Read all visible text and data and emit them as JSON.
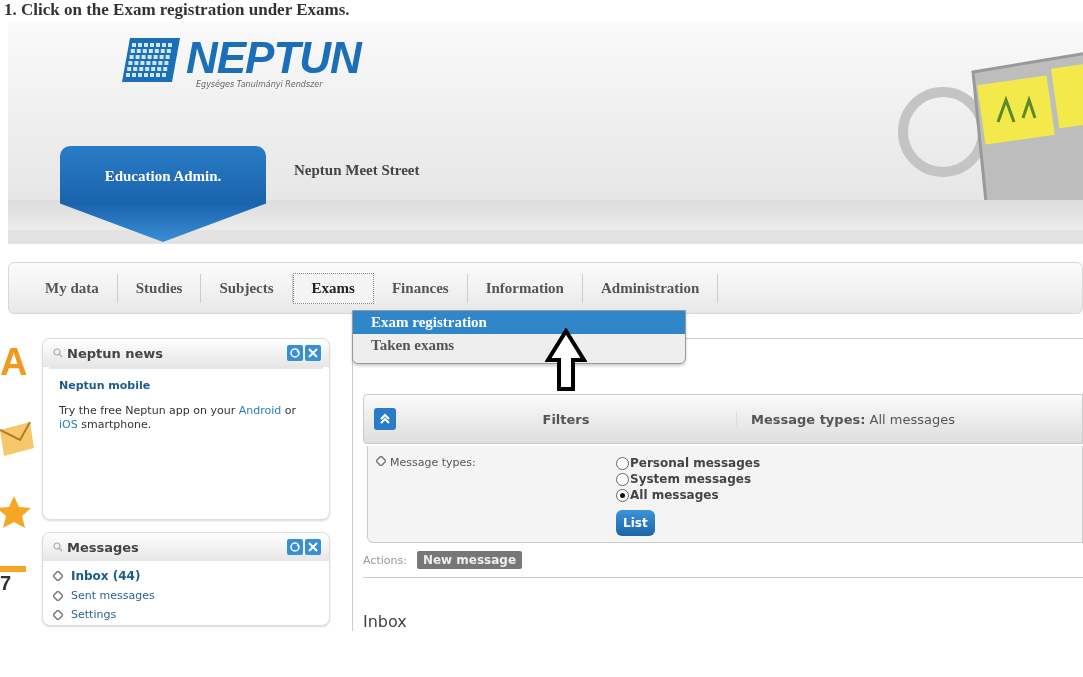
{
  "caption": "1. Click on the Exam registration under Exams.",
  "logo": {
    "name": "NEPTUN",
    "tagline": "Egységes Tanulmányi Rendszer"
  },
  "header_tabs": [
    {
      "label": "Education Admin.",
      "selected": true
    },
    {
      "label": "Neptun Meet Street",
      "selected": false
    }
  ],
  "menu": [
    {
      "label": "My data",
      "selected": false
    },
    {
      "label": "Studies",
      "selected": false
    },
    {
      "label": "Subjects",
      "selected": false
    },
    {
      "label": "Exams",
      "selected": true
    },
    {
      "label": "Finances",
      "selected": false
    },
    {
      "label": "Information",
      "selected": false
    },
    {
      "label": "Administration",
      "selected": false
    }
  ],
  "dropdown": [
    {
      "label": "Exam registration",
      "selected": true
    },
    {
      "label": "Taken exams",
      "selected": false
    }
  ],
  "side_letter": "A",
  "side_calendar_day": "7",
  "news_box": {
    "title": "Neptun news",
    "headline": "Neptun mobile",
    "body": [
      {
        "kind": "text",
        "text": "Try the free Neptun app on your"
      },
      {
        "kind": "link",
        "text": "Android"
      },
      {
        "kind": "text",
        "text": "or"
      },
      {
        "kind": "link",
        "text": "iOS"
      },
      {
        "kind": "text",
        "text": "smartphone."
      }
    ]
  },
  "messages_box": {
    "title": "Messages",
    "items": [
      {
        "label": "Inbox (44)",
        "selected": true
      },
      {
        "label": "Sent messages",
        "selected": false
      },
      {
        "label": "Settings",
        "selected": false
      }
    ]
  },
  "filters": {
    "title": "Filters",
    "summary_label": "Message types:",
    "summary_value": "All messages",
    "field_label": "Message types:",
    "options": [
      {
        "label": "Personal messages",
        "selected": false
      },
      {
        "label": "System messages",
        "selected": false
      },
      {
        "label": "All messages",
        "selected": true
      }
    ],
    "button": "List"
  },
  "actions": {
    "label": "Actions:",
    "button": "New message"
  },
  "section_title": "Inbox"
}
